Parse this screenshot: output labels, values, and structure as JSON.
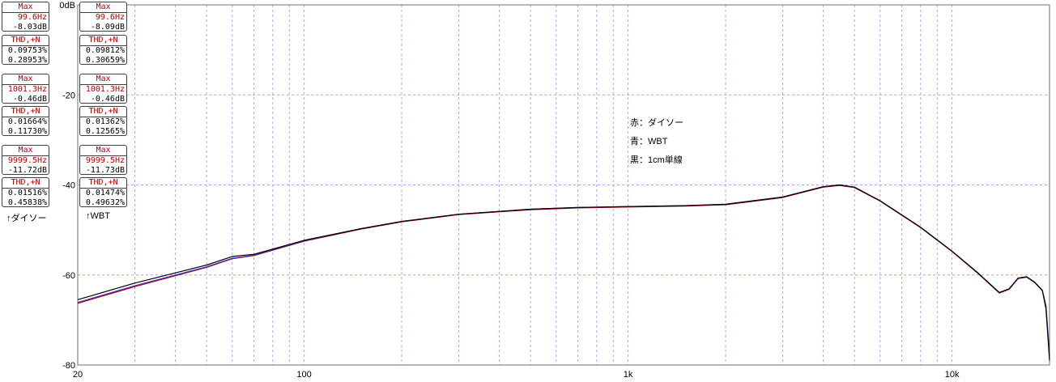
{
  "chart_data": {
    "type": "line",
    "x_scale": "log",
    "xlim": [
      20,
      20000
    ],
    "ylim": [
      -80,
      0
    ],
    "x_ticks": [
      {
        "value": 20,
        "label": "20"
      },
      {
        "value": 100,
        "label": "100"
      },
      {
        "value": 1000,
        "label": "1k"
      },
      {
        "value": 10000,
        "label": "10k"
      }
    ],
    "y_ticks": [
      {
        "value": 0,
        "label": "0dB"
      },
      {
        "value": -20,
        "label": "-20"
      },
      {
        "value": -40,
        "label": "-40"
      },
      {
        "value": -60,
        "label": "-60"
      },
      {
        "value": -80,
        "label": "-80"
      }
    ],
    "grid": true,
    "annotations": [
      "赤：ダイソー",
      "青：WBT",
      "黒：1cm単線"
    ],
    "series": [
      {
        "color": "#c00000",
        "x": [
          20,
          30,
          50,
          60,
          70,
          100,
          150,
          200,
          300,
          500,
          700,
          1000,
          1500,
          2000,
          3000,
          4000,
          4500,
          5000,
          6000,
          8000,
          10000,
          12000,
          14000,
          15000,
          16000,
          17000,
          18000,
          19000,
          19500,
          20000
        ],
        "y": [
          -66.3,
          -62.6,
          -58.3,
          -56.4,
          -55.7,
          -52.5,
          -49.8,
          -48.2,
          -46.6,
          -45.5,
          -45.1,
          -44.9,
          -44.7,
          -44.4,
          -42.8,
          -40.5,
          -40.1,
          -40.6,
          -43.6,
          -49.5,
          -54.8,
          -59.6,
          -64,
          -63.2,
          -60.8,
          -60.5,
          -61.7,
          -63.5,
          -67,
          -78
        ]
      },
      {
        "color": "#3030c0",
        "x": [
          20,
          30,
          50,
          60,
          70,
          100,
          150,
          200,
          300,
          500,
          700,
          1000,
          1500,
          2000,
          3000,
          4000,
          4500,
          5000,
          6000,
          8000,
          10000,
          12000,
          14000,
          15000,
          16000,
          17000,
          18000,
          19000,
          19500,
          20000
        ],
        "y": [
          -66.1,
          -62.4,
          -58.2,
          -56.3,
          -55.6,
          -52.4,
          -49.7,
          -48.1,
          -46.5,
          -45.4,
          -45.0,
          -44.8,
          -44.6,
          -44.3,
          -42.7,
          -40.4,
          -40.0,
          -40.5,
          -43.5,
          -49.4,
          -54.7,
          -59.5,
          -63.9,
          -63.1,
          -60.7,
          -60.4,
          -61.6,
          -63.4,
          -66.8,
          -77.8
        ]
      },
      {
        "color": "#000000",
        "x": [
          20,
          30,
          50,
          60,
          70,
          100,
          150,
          200,
          300,
          500,
          700,
          1000,
          1500,
          2000,
          3000,
          4000,
          4500,
          5000,
          6000,
          8000,
          10000,
          12000,
          14000,
          15000,
          16000,
          17000,
          18000,
          19000,
          19500,
          20000
        ],
        "y": [
          -65.5,
          -61.8,
          -57.8,
          -55.9,
          -55.4,
          -52.3,
          -49.7,
          -48.1,
          -46.5,
          -45.4,
          -45.0,
          -44.8,
          -44.6,
          -44.3,
          -42.7,
          -40.4,
          -40.0,
          -40.5,
          -43.5,
          -49.4,
          -54.7,
          -59.5,
          -63.9,
          -63.1,
          -60.7,
          -60.4,
          -61.6,
          -63.4,
          -67.5,
          -79
        ]
      }
    ]
  },
  "panels": {
    "left": {
      "max1": {
        "header": "Max",
        "freq": "99.6Hz",
        "level": "-8.03dB"
      },
      "thd1": {
        "header": "THD,+N",
        "v1": "0.09753%",
        "v2": "0.28953%"
      },
      "max2": {
        "header": "Max",
        "freq": "1001.3Hz",
        "level": "-0.46dB"
      },
      "thd2": {
        "header": "THD,+N",
        "v1": "0.01664%",
        "v2": "0.11730%"
      },
      "max3": {
        "header": "Max",
        "freq": "9999.5Hz",
        "level": "-11.72dB"
      },
      "thd3": {
        "header": "THD,+N",
        "v1": "0.01516%",
        "v2": "0.45838%"
      },
      "footer": "↑ダイソー"
    },
    "right": {
      "max1": {
        "header": "Max",
        "freq": "99.6Hz",
        "level": "-8.09dB"
      },
      "thd1": {
        "header": "THD,+N",
        "v1": "0.09812%",
        "v2": "0.30659%"
      },
      "max2": {
        "header": "Max",
        "freq": "1001.3Hz",
        "level": "-0.46dB"
      },
      "thd2": {
        "header": "THD,+N",
        "v1": "0.01362%",
        "v2": "0.12565%"
      },
      "max3": {
        "header": "Max",
        "freq": "9999.5Hz",
        "level": "-11.73dB"
      },
      "thd3": {
        "header": "THD,+N",
        "v1": "0.01474%",
        "v2": "0.49632%"
      },
      "footer": "↑WBT"
    }
  }
}
